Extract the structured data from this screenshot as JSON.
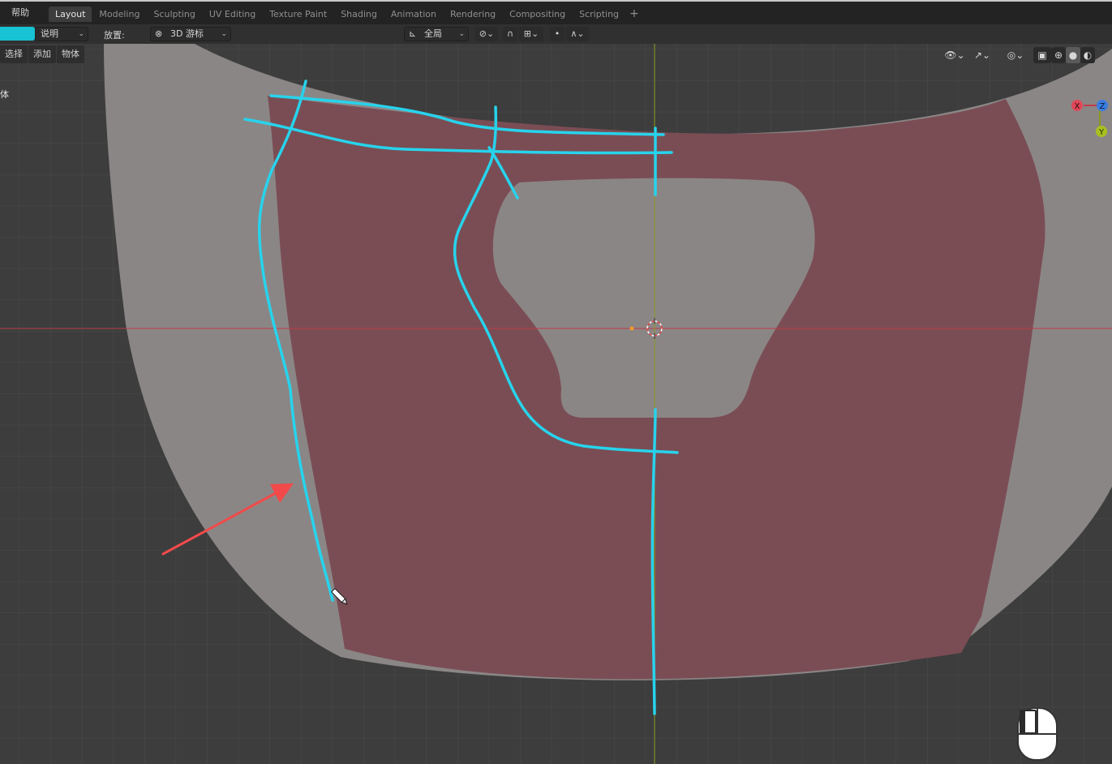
{
  "top_menu": {
    "help": "帮助"
  },
  "workspace_tabs": [
    {
      "label": "Layout",
      "active": true
    },
    {
      "label": "Modeling",
      "active": false
    },
    {
      "label": "Sculpting",
      "active": false
    },
    {
      "label": "UV Editing",
      "active": false
    },
    {
      "label": "Texture Paint",
      "active": false
    },
    {
      "label": "Shading",
      "active": false
    },
    {
      "label": "Animation",
      "active": false
    },
    {
      "label": "Rendering",
      "active": false
    },
    {
      "label": "Compositing",
      "active": false
    },
    {
      "label": "Scripting",
      "active": false
    }
  ],
  "add_workspace": "+",
  "tool_header": {
    "mode_value": "说明",
    "placement_label": "放置:",
    "placement_value": "3D 游标",
    "orientation_value": "全局"
  },
  "editor_menu": {
    "select": "选择",
    "add": "添加",
    "object": "物体"
  },
  "side_label": "体",
  "gizmo": {
    "x": "X",
    "y": "Y",
    "z": "Z"
  },
  "icons": {
    "placement": "cursor-target-icon",
    "orientation": "transform-orientation-icon",
    "pivot": "link-pivot-icon",
    "snap": "magnet-snap-icon",
    "snap_target": "increment-icon",
    "proportional": "proportional-editing-icon",
    "falloff": "falloff-curve-icon",
    "visibility": "eye-visibility-icon",
    "gizmo": "gizmo-arrows-icon",
    "overlay": "overlay-icon",
    "xray": "xray-icon",
    "shading_wire": "wireframe-shading-icon",
    "shading_solid": "solid-shading-icon",
    "shading_material": "material-shading-icon",
    "pencil_cursor": "pencil-cursor-icon",
    "mouse": "mouse-left-button-icon"
  },
  "colors": {
    "annotation": "#27d3ec",
    "arrow": "#f24a4a",
    "face_fill": "#7a4d54",
    "mesh_gray": "#8b8686",
    "x_axis": "#c13c46",
    "y_axis": "#8a9a1e"
  }
}
